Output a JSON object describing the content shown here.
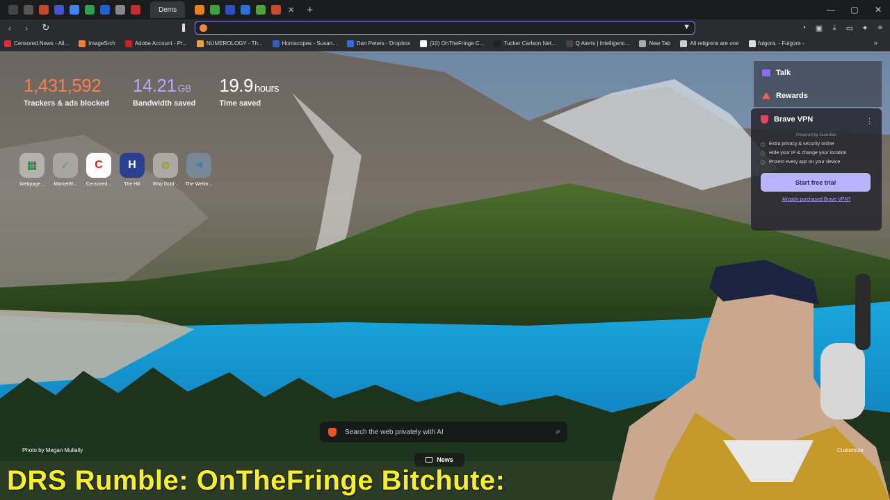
{
  "tabs": {
    "active_label": "Dems",
    "favicon_colors": [
      "#444",
      "#555",
      "#c04a2a",
      "#4455cc",
      "#3b83f6",
      "#30a050",
      "#2060d0",
      "#888",
      "#c03030",
      "#e68020",
      "#40a040",
      "#3050c0",
      "#2f6fd6",
      "#50a040",
      "#c84a32"
    ]
  },
  "toolbar": {
    "back": "‹",
    "forward": "›",
    "reload": "↻",
    "bookmark": "🔖",
    "shield": "▼"
  },
  "bookmarks": [
    {
      "label": "Censored.News - All...",
      "color": "#d83030"
    },
    {
      "label": "ImageSrch",
      "color": "#f08040"
    },
    {
      "label": "Adobe Account - Pr...",
      "color": "#d02020"
    },
    {
      "label": "NUMEROLOGY - Th...",
      "color": "#f0a040"
    },
    {
      "label": "Horoscopes - Susan...",
      "color": "#3060c0"
    },
    {
      "label": "Dan Peters - Dropbox",
      "color": "#2f6fe0"
    },
    {
      "label": "(10) OnTheFringe C...",
      "color": "#ffffff"
    },
    {
      "label": "Tucker Carlson Net...",
      "color": "#222222"
    },
    {
      "label": "Q Alerts | Intelligenc...",
      "color": "#444444"
    },
    {
      "label": "New Tab",
      "color": "#aaaaaa"
    },
    {
      "label": "All religions are one",
      "color": "#cccccc"
    },
    {
      "label": "fulgora. - Fulgora -",
      "color": "#dddddd"
    }
  ],
  "stats": {
    "trackers_value": "1,431,592",
    "trackers_label": "Trackers & ads blocked",
    "bandwidth_value": "14.21",
    "bandwidth_unit": "GB",
    "bandwidth_label": "Bandwidth saved",
    "time_value": "19.9",
    "time_unit": "hours",
    "time_label": "Time saved"
  },
  "tiles": [
    {
      "label": "Webpage...",
      "glyph": "▦"
    },
    {
      "label": "MarketW...",
      "glyph": "✓"
    },
    {
      "label": "Censored...",
      "glyph": "C"
    },
    {
      "label": "The Hill",
      "glyph": "H"
    },
    {
      "label": "Why Gold...",
      "glyph": "⊘"
    },
    {
      "label": "The Wellin...",
      "glyph": "◄"
    }
  ],
  "widgets": {
    "talk": "Talk",
    "rewards": "Rewards",
    "vpn_title": "Brave VPN",
    "vpn_powered": "Powered by Guardian",
    "vpn_features": [
      "Extra privacy & security online",
      "Hide your IP & change your location",
      "Protect every app on your device"
    ],
    "vpn_button": "Start free trial",
    "vpn_link": "Already purchased Brave VPN?"
  },
  "search": {
    "placeholder": "Search the web privately with AI"
  },
  "news_label": "News",
  "photo_credit": "Photo by Megan Mullally",
  "customize_label": "Customize",
  "caption": "DRS Rumble: OnTheFringe Bitchute:"
}
